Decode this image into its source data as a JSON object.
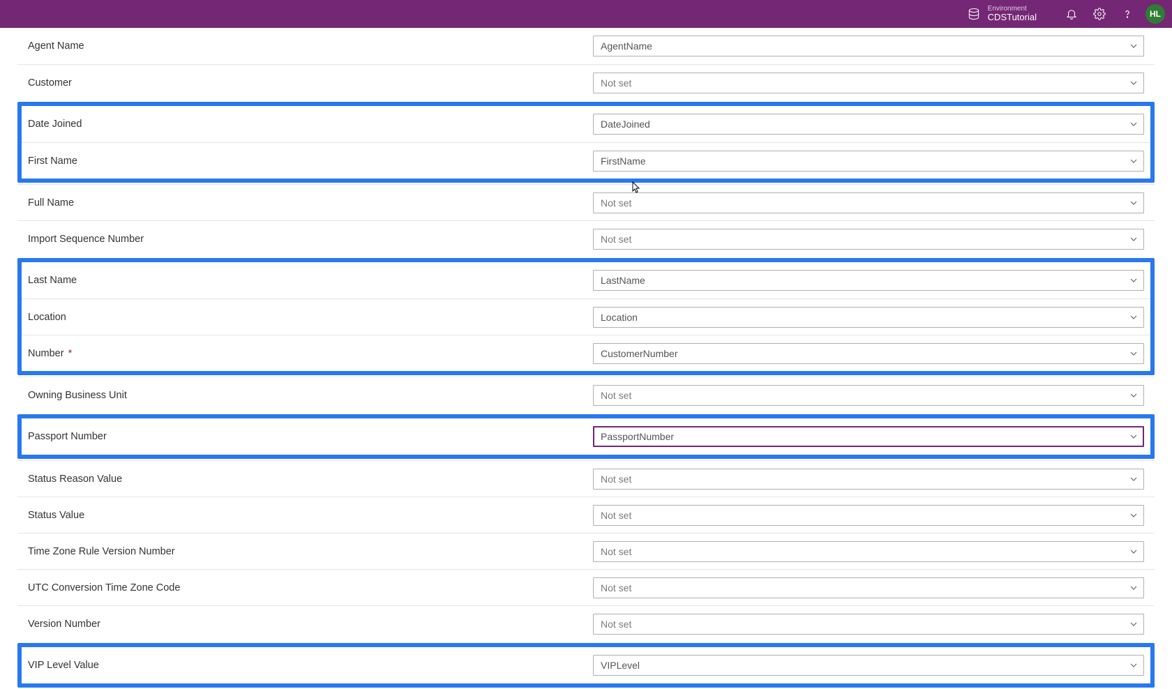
{
  "header": {
    "envLabel": "Environment",
    "envName": "CDSTutorial",
    "avatarInitials": "HL"
  },
  "rows": [
    {
      "label": "Agent Name",
      "value": "AgentName",
      "required": false,
      "highlight": 0,
      "focused": false
    },
    {
      "label": "Customer",
      "value": "Not set",
      "required": false,
      "highlight": 0,
      "focused": false
    },
    {
      "label": "Date Joined",
      "value": "DateJoined",
      "required": false,
      "highlight": 1,
      "focused": false
    },
    {
      "label": "First Name",
      "value": "FirstName",
      "required": false,
      "highlight": 1,
      "focused": false
    },
    {
      "label": "Full Name",
      "value": "Not set",
      "required": false,
      "highlight": 0,
      "focused": false
    },
    {
      "label": "Import Sequence Number",
      "value": "Not set",
      "required": false,
      "highlight": 0,
      "focused": false
    },
    {
      "label": "Last Name",
      "value": "LastName",
      "required": false,
      "highlight": 2,
      "focused": false
    },
    {
      "label": "Location",
      "value": "Location",
      "required": false,
      "highlight": 2,
      "focused": false
    },
    {
      "label": "Number",
      "value": "CustomerNumber",
      "required": true,
      "highlight": 2,
      "focused": false
    },
    {
      "label": "Owning Business Unit",
      "value": "Not set",
      "required": false,
      "highlight": 0,
      "focused": false
    },
    {
      "label": "Passport Number",
      "value": "PassportNumber",
      "required": false,
      "highlight": 3,
      "focused": true
    },
    {
      "label": "Status Reason Value",
      "value": "Not set",
      "required": false,
      "highlight": 0,
      "focused": false
    },
    {
      "label": "Status Value",
      "value": "Not set",
      "required": false,
      "highlight": 0,
      "focused": false
    },
    {
      "label": "Time Zone Rule Version Number",
      "value": "Not set",
      "required": false,
      "highlight": 0,
      "focused": false
    },
    {
      "label": "UTC Conversion Time Zone Code",
      "value": "Not set",
      "required": false,
      "highlight": 0,
      "focused": false
    },
    {
      "label": "Version Number",
      "value": "Not set",
      "required": false,
      "highlight": 0,
      "focused": false
    },
    {
      "label": "VIP Level Value",
      "value": "VIPLevel",
      "required": false,
      "highlight": 4,
      "focused": false
    }
  ]
}
